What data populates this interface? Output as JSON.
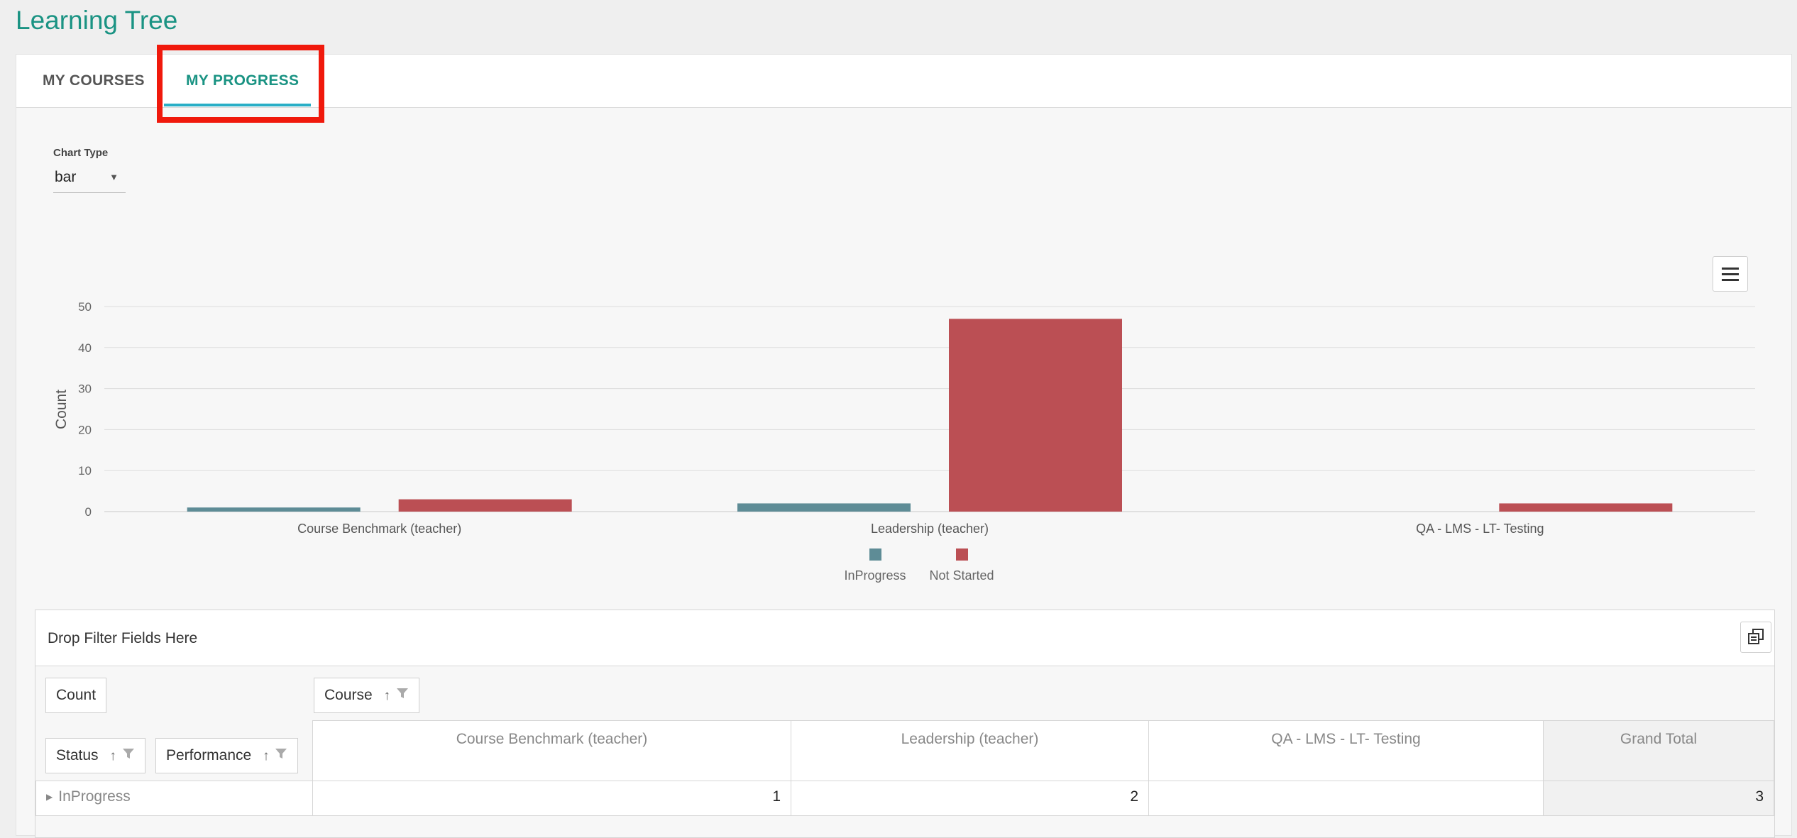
{
  "app": {
    "title": "Learning Tree"
  },
  "tabs": [
    {
      "label": "MY COURSES",
      "active": false
    },
    {
      "label": "MY PROGRESS",
      "active": true
    }
  ],
  "chart_type": {
    "label": "Chart Type",
    "value": "bar"
  },
  "chart_data": {
    "type": "bar",
    "categories": [
      "Course Benchmark (teacher)",
      "Leadership (teacher)",
      "QA - LMS - LT- Testing"
    ],
    "series": [
      {
        "name": "InProgress",
        "values": [
          1,
          2,
          0
        ],
        "color": "#5e8c96"
      },
      {
        "name": "Not Started",
        "values": [
          3,
          47,
          2
        ],
        "color": "#bb4f54"
      }
    ],
    "title": "",
    "xlabel": "",
    "ylabel": "Count",
    "ylim": [
      0,
      50
    ],
    "yticks": [
      0,
      10,
      20,
      30,
      40,
      50
    ],
    "grid": true,
    "legend_position": "bottom-center"
  },
  "pivot": {
    "filter_placeholder": "Drop Filter Fields Here",
    "measure": "Count",
    "column_field": "Course",
    "row_fields": [
      "Status",
      "Performance"
    ],
    "sort_glyph": "↑",
    "columns": [
      "Course Benchmark (teacher)",
      "Leadership (teacher)",
      "QA - LMS - LT- Testing",
      "Grand Total"
    ],
    "rows": [
      {
        "label": "InProgress",
        "values": [
          "1",
          "2",
          "",
          "3"
        ]
      }
    ]
  }
}
